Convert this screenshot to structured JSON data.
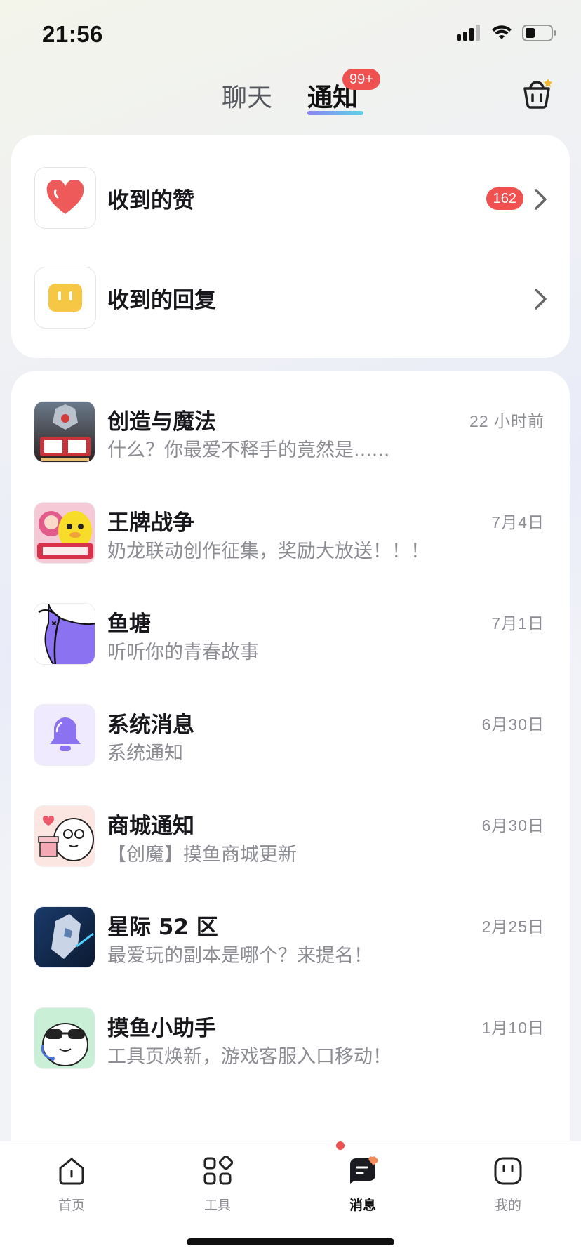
{
  "status_bar": {
    "time": "21:56"
  },
  "tabs": {
    "chat": "聊天",
    "notify": "通知",
    "notify_badge": "99+"
  },
  "top_card": {
    "likes": {
      "label": "收到的赞",
      "count": "162"
    },
    "replies": {
      "label": "收到的回复"
    }
  },
  "messages": [
    {
      "title": "创造与魔法",
      "preview": "什么？你最爱不释手的竟然是......",
      "time": "22 小时前",
      "avatar_icon": "creation-magic-game-icon"
    },
    {
      "title": "王牌战争",
      "preview": "奶龙联动创作征集，奖励大放送！！！",
      "time": "7月4日",
      "avatar_icon": "ace-war-game-icon"
    },
    {
      "title": "鱼塘",
      "preview": "听听你的青春故事",
      "time": "7月1日",
      "avatar_icon": "fish-pond-icon"
    },
    {
      "title": "系统消息",
      "preview": "系统通知",
      "time": "6月30日",
      "avatar_icon": "bell-icon"
    },
    {
      "title": "商城通知",
      "preview": "【创魔】摸鱼商城更新",
      "time": "6月30日",
      "avatar_icon": "mascot-gift-icon"
    },
    {
      "title": "星际 52 区",
      "preview": "最爱玩的副本是哪个？来提名！",
      "time": "2月25日",
      "avatar_icon": "star-zone-game-icon"
    },
    {
      "title": "摸鱼小助手",
      "preview": "工具页焕新，游戏客服入口移动！",
      "time": "1月10日",
      "avatar_icon": "assistant-mascot-icon"
    }
  ],
  "bottom_nav": [
    {
      "label": "首页",
      "icon": "home-icon"
    },
    {
      "label": "工具",
      "icon": "tools-grid-icon"
    },
    {
      "label": "消息",
      "icon": "message-icon",
      "active": true
    },
    {
      "label": "我的",
      "icon": "profile-icon"
    }
  ],
  "colors": {
    "badge_red": "#ef5151",
    "heart_red": "#ee5a5a",
    "reply_yellow": "#f6c744",
    "accent_purple": "#8a84f2"
  }
}
